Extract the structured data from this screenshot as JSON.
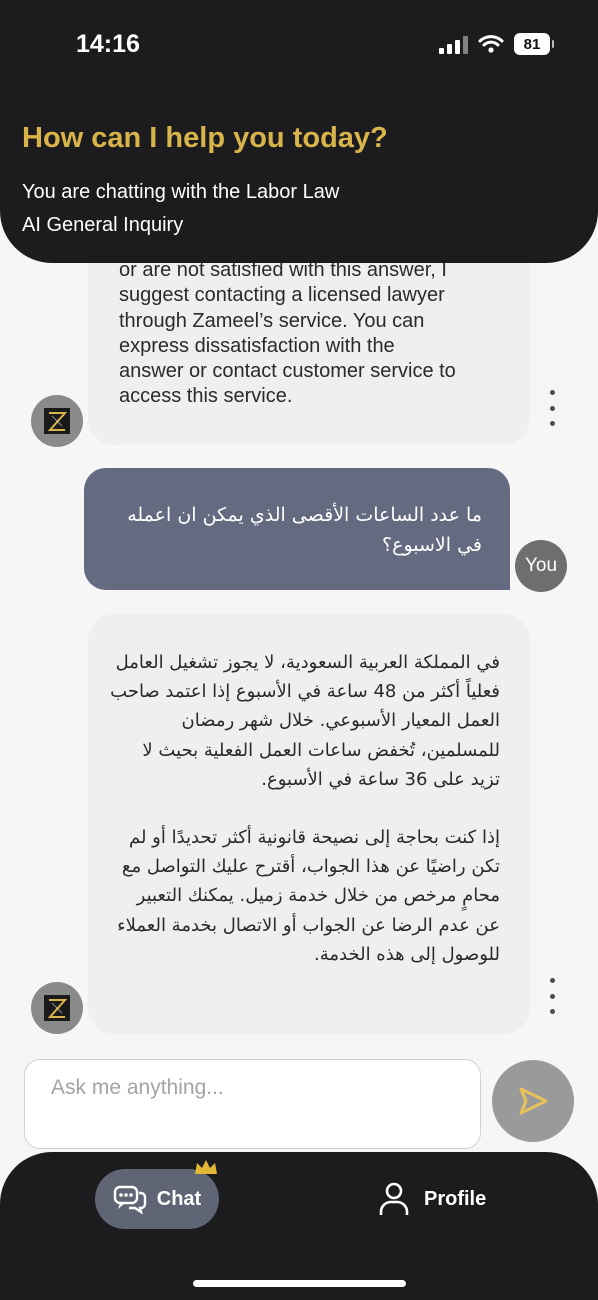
{
  "status_bar": {
    "time": "14:16",
    "battery": "81"
  },
  "header": {
    "title": "How can I help you today?",
    "subtitle_line1": "You are chatting with the Labor Law",
    "subtitle_line2": "AI General Inquiry"
  },
  "messages": [
    {
      "sender": "assistant",
      "lines": [
        "or are not satisfied with this answer, I",
        "suggest contacting a licensed lawyer",
        "through Zameel’s service. You can",
        "express dissatisfaction with the",
        "answer or contact customer service to",
        "access this service."
      ]
    },
    {
      "sender": "user",
      "avatar_label": "You",
      "text": "ما عدد الساعات الأقصى الذي يمكن ان اعمله في الاسبوع؟"
    },
    {
      "sender": "assistant",
      "paragraph1": "في المملكة العربية السعودية، لا يجوز تشغيل العامل فعلياً أكثر من 48 ساعة في الأسبوع إذا اعتمد صاحب العمل المعيار الأسبوعي. خلال شهر رمضان للمسلمين، تُخفض ساعات العمل الفعلية بحيث لا تزيد على 36 ساعة في الأسبوع.",
      "paragraph2": "إذا كنت بحاجة إلى نصيحة قانونية أكثر تحديدًا أو لم تكن راضيًا عن هذا الجواب، أقترح عليك التواصل مع محامٍ مرخص من خلال خدمة زميل. يمكنك التعبير عن عدم الرضا عن الجواب أو الاتصال بخدمة العملاء للوصول إلى هذه الخدمة."
    }
  ],
  "input": {
    "placeholder": "Ask me anything...",
    "value": ""
  },
  "nav": {
    "chat_label": "Chat",
    "profile_label": "Profile"
  },
  "colors": {
    "header_bg": "#1c1c1e",
    "accent_gold": "#d9b44a",
    "user_bubble": "#646b81",
    "bot_bubble": "#efeff1",
    "nav_active_pill": "#5f6574"
  },
  "icons": [
    "signal-icon",
    "wifi-icon",
    "battery-icon",
    "bot-avatar-logo-icon",
    "more-options-icon",
    "send-icon",
    "chat-bubbles-icon",
    "crown-icon",
    "profile-icon"
  ]
}
